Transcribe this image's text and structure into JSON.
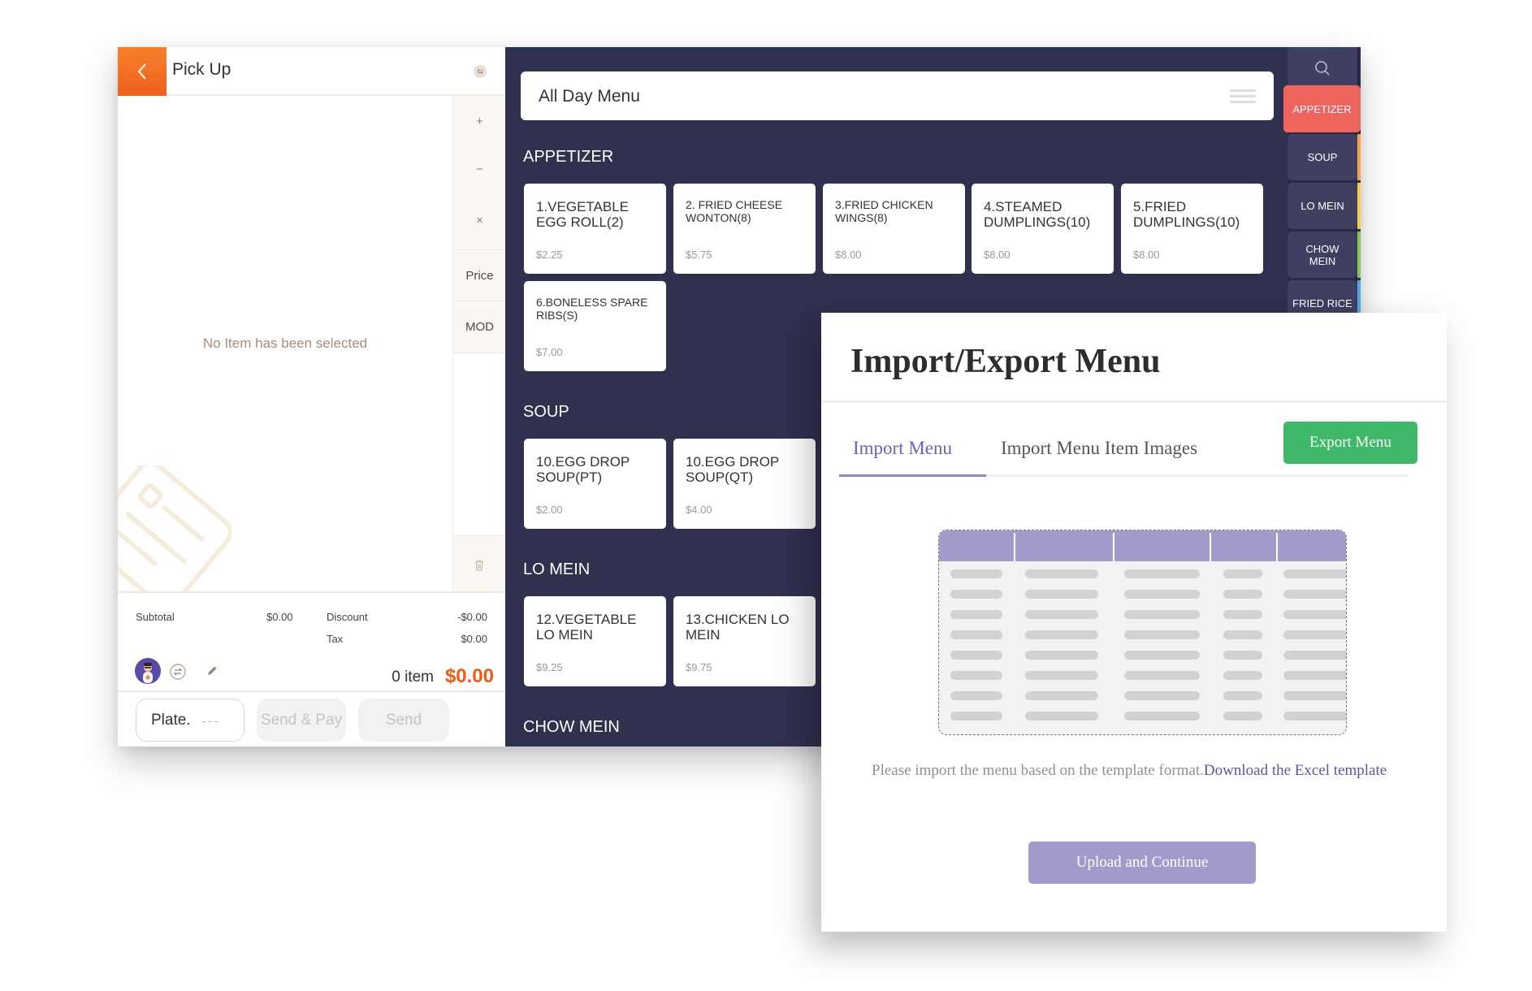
{
  "order": {
    "title": "Pick Up",
    "empty_message": "No Item has been selected",
    "actions": {
      "plus": "+",
      "minus": "−",
      "remove": "×",
      "price": "Price",
      "mod": "MOD",
      "more": "· · ·"
    },
    "totals": {
      "subtotal_label": "Subtotal",
      "subtotal_value": "$0.00",
      "discount_label": "Discount",
      "discount_value": "-$0.00",
      "tax_label": "Tax",
      "tax_value": "$0.00",
      "item_count": "0 item",
      "grand_total": "$0.00"
    },
    "footer": {
      "plate_label": "Plate.",
      "plate_value": "---",
      "send_pay_label": "Send & Pay",
      "send_label": "Send"
    }
  },
  "menu": {
    "selector_label": "All Day Menu",
    "categories": [
      {
        "name": "APPETIZER",
        "items": [
          {
            "name": "1.VEGETABLE EGG ROLL(2)",
            "price": "$2.25"
          },
          {
            "name": "2. FRIED CHEESE WONTON(8)",
            "price": "$5.75"
          },
          {
            "name": "3.FRIED CHICKEN WINGS(8)",
            "price": "$8.00"
          },
          {
            "name": "4.STEAMED DUMPLINGS(10)",
            "price": "$8.00"
          },
          {
            "name": "5.FRIED DUMPLINGS(10)",
            "price": "$8.00"
          },
          {
            "name": "6.BONELESS SPARE RIBS(S)",
            "price": "$7.00"
          }
        ]
      },
      {
        "name": "SOUP",
        "items": [
          {
            "name": "10.EGG DROP SOUP(PT)",
            "price": "$2.00"
          },
          {
            "name": "10.EGG DROP SOUP(QT)",
            "price": "$4.00"
          }
        ]
      },
      {
        "name": "LO MEIN",
        "items": [
          {
            "name": "12.VEGETABLE LO MEIN",
            "price": "$9.25"
          },
          {
            "name": "13.CHICKEN LO MEIN",
            "price": "$9.75"
          }
        ]
      },
      {
        "name": "CHOW MEIN",
        "items": []
      }
    ]
  },
  "sidebar": {
    "search_icon": "search-icon",
    "items": [
      {
        "label": "APPETIZER",
        "active": true,
        "color": "#f06460"
      },
      {
        "label": "SOUP",
        "active": false,
        "color": "#f5a440"
      },
      {
        "label": "LO MEIN",
        "active": false,
        "color": "#f4cf3f"
      },
      {
        "label": "CHOW MEIN",
        "active": false,
        "color": "#8dc34f"
      },
      {
        "label": "FRIED RICE",
        "active": false,
        "color": "#4fa8e8"
      }
    ]
  },
  "dialog": {
    "title": "Import/Export Menu",
    "tabs": [
      {
        "label": "Import Menu",
        "active": true
      },
      {
        "label": "Import Menu Item Images",
        "active": false
      }
    ],
    "export_label": "Export Menu",
    "helper_text": "Please import the menu based on the template format.",
    "helper_link": "Download the Excel template",
    "upload_label": "Upload and Continue"
  },
  "colors": {
    "accent_orange": "#f05a14",
    "menu_bg": "#30304f",
    "dialog_accent": "#6b63b5",
    "export_green": "#3fb86a",
    "upload_purple": "#a39bcb"
  }
}
